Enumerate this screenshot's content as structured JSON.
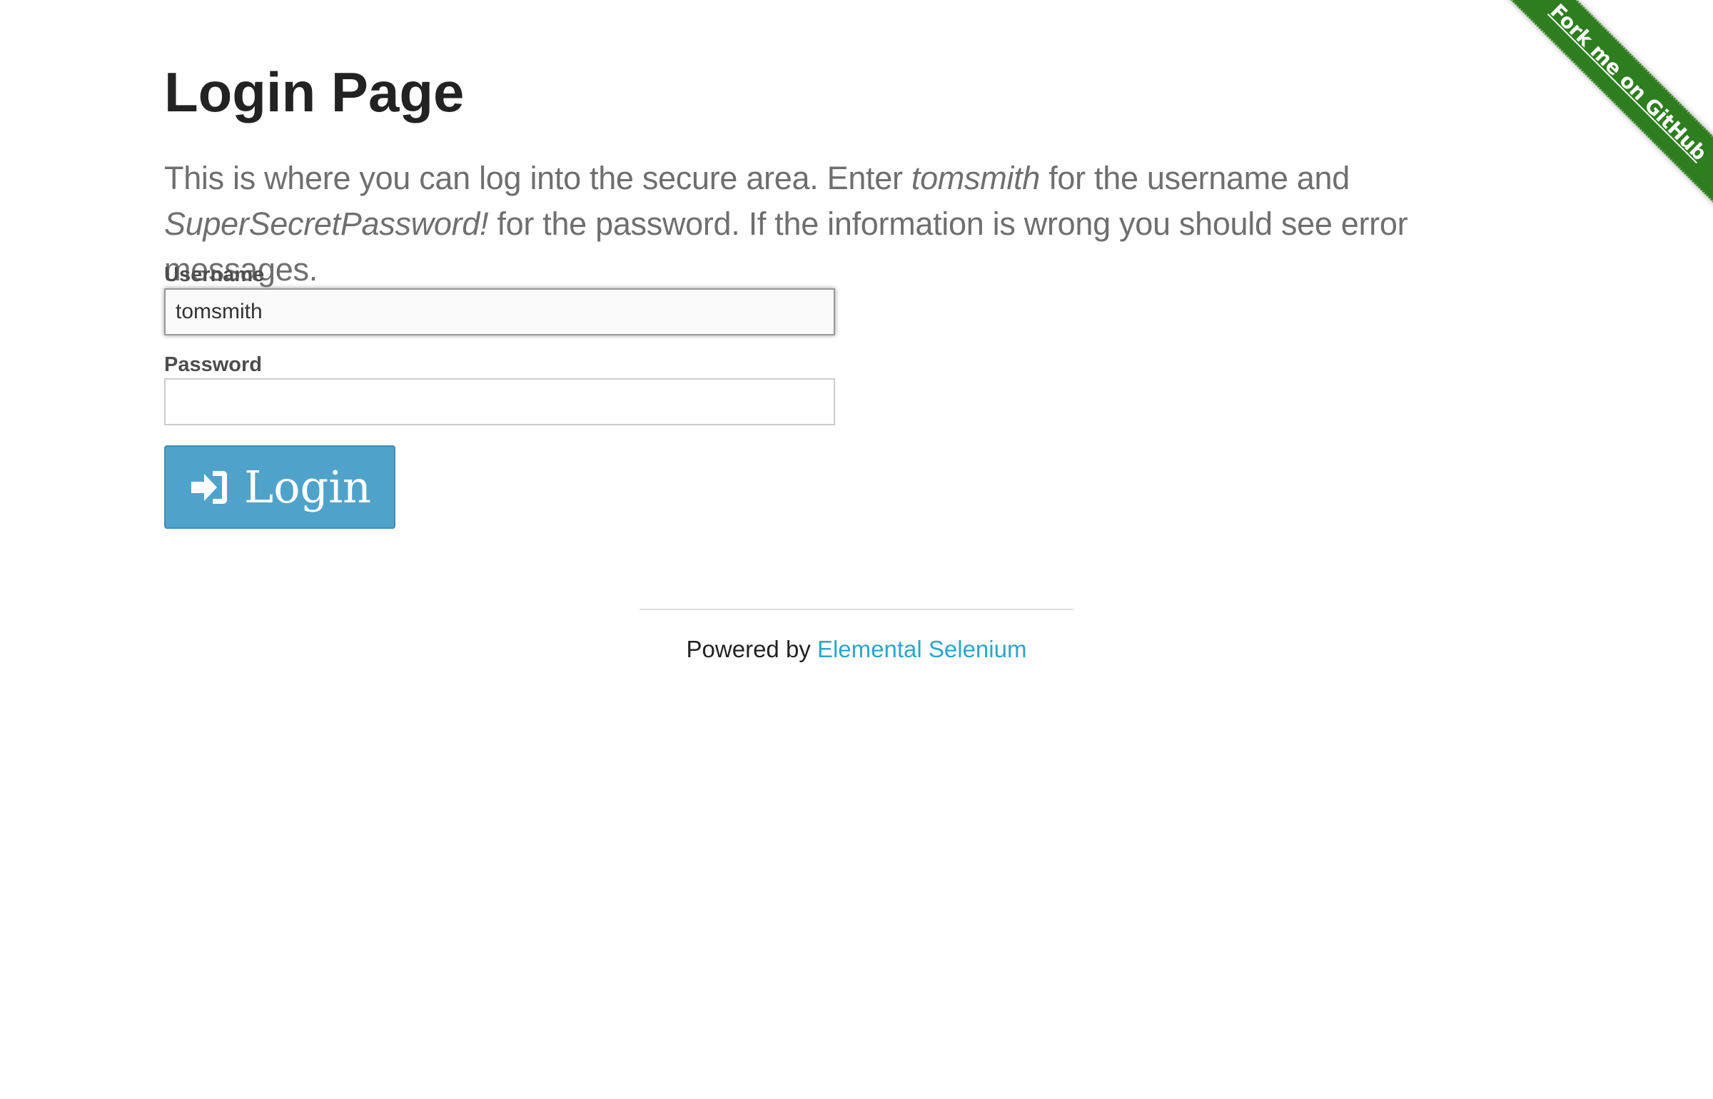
{
  "page": {
    "title": "Login Page",
    "intro": {
      "part1": "This is where you can log into the secure area. Enter ",
      "username_hint": "tomsmith",
      "part2": " for the username and ",
      "password_hint": "SuperSecretPassword!",
      "part3": " for the password. If the information is wrong you should see error messages."
    }
  },
  "form": {
    "username_label": "Username",
    "username_value": "tomsmith",
    "password_label": "Password",
    "password_value": "",
    "login_button": {
      "label": "Login",
      "icon": "sign-in-icon"
    }
  },
  "footer": {
    "prefix": "Powered by ",
    "link_text": "Elemental Selenium"
  },
  "ribbon": {
    "text": "Fork me on GitHub",
    "color": "#2e7d1f"
  },
  "colors": {
    "button": "#4fa3cb",
    "link": "#2ba6cb"
  }
}
